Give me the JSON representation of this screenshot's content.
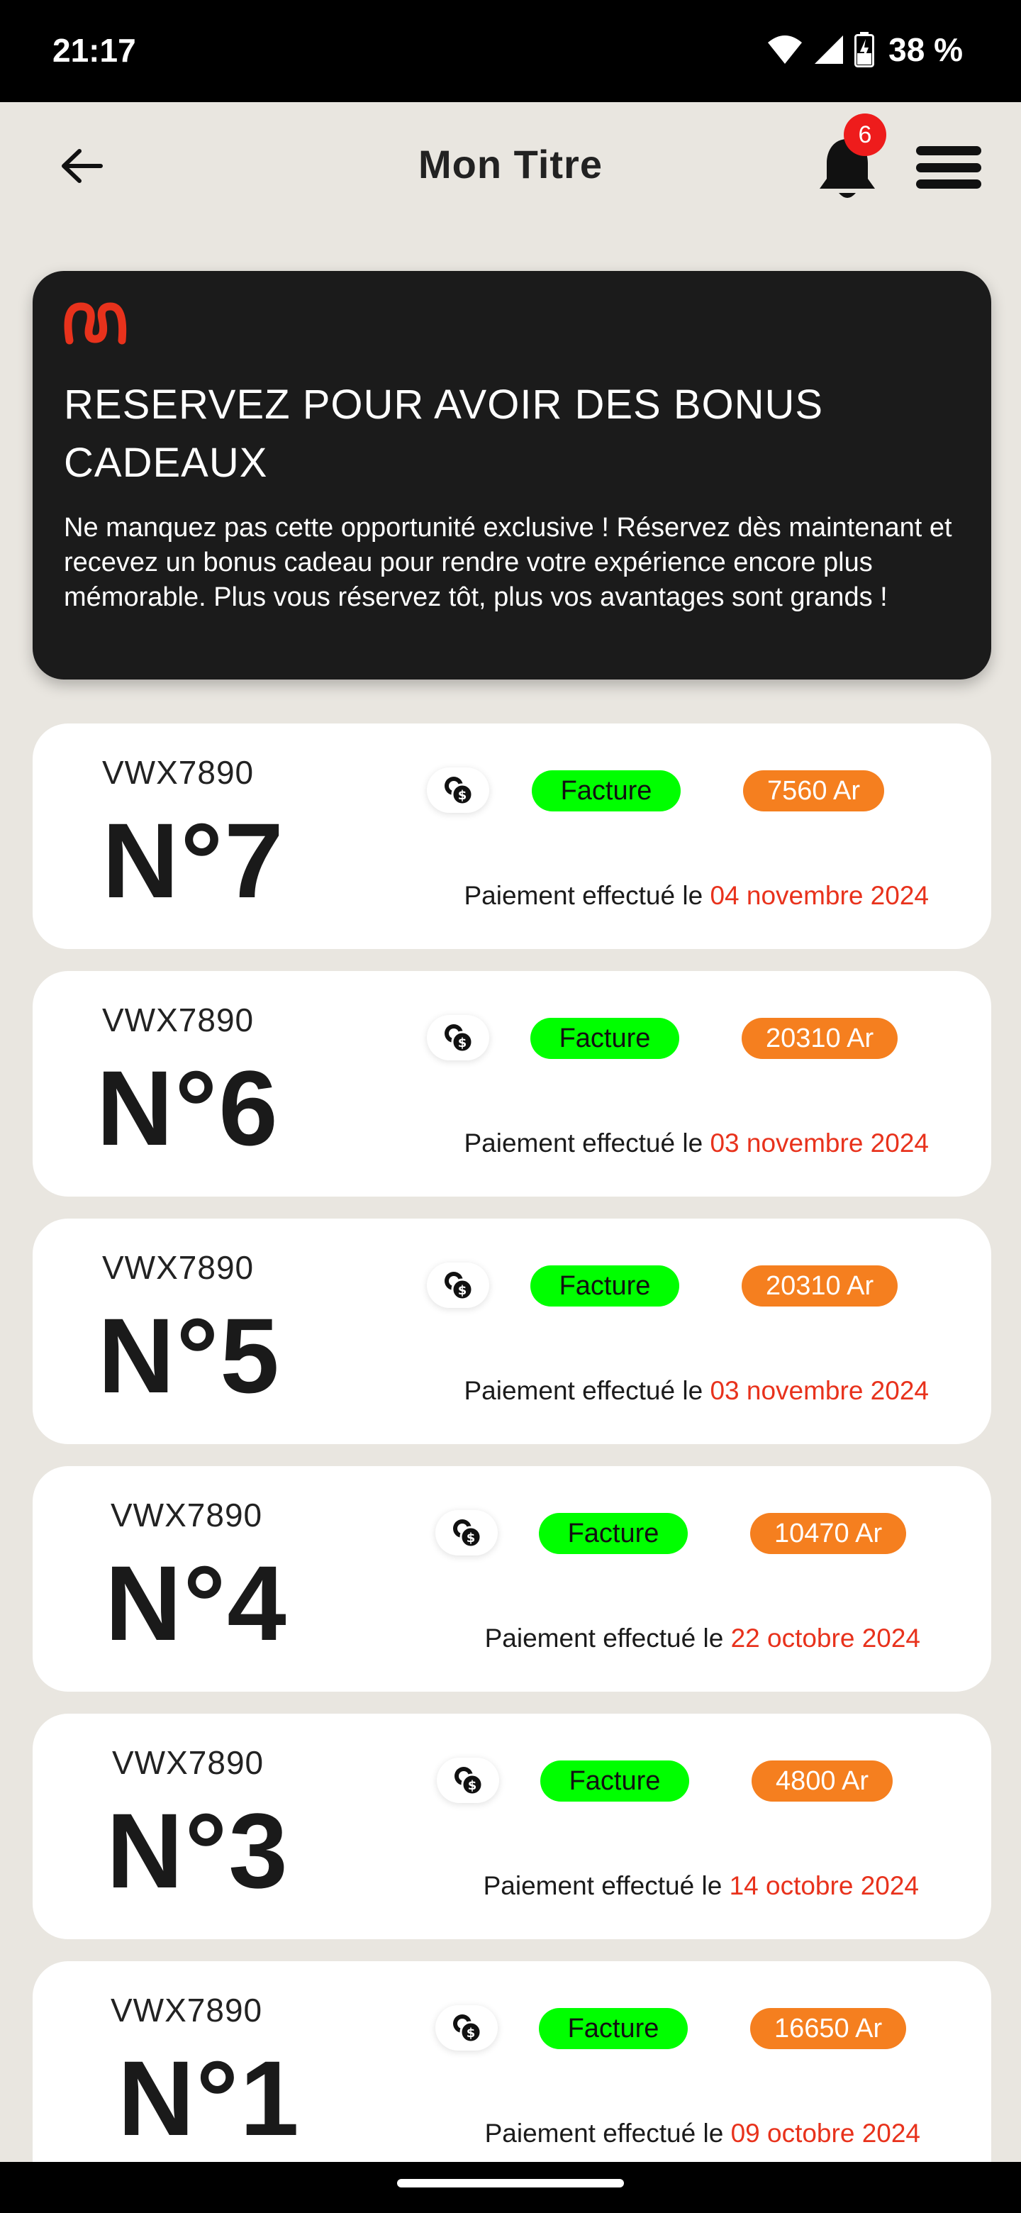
{
  "status_bar": {
    "time": "21:17",
    "battery": "38 %"
  },
  "header": {
    "title": "Mon Titre",
    "notification_count": "6",
    "icons": [
      "arrow-left-icon",
      "bell-icon",
      "hamburger-menu-icon"
    ]
  },
  "promo": {
    "headline": "RESERVEZ POUR AVOIR DES BONUS CADEAUX",
    "body": "Ne manquez pas cette opportunité exclusive ! Réservez dès maintenant et recevez un bonus cadeau pour rendre votre expérience encore plus mémorable. Plus vous réservez tôt, plus vos avantages sont grands !",
    "logo_color": "#e8321c"
  },
  "cards": [
    {
      "ref": "VWX7890",
      "number": "N°7",
      "badge": "Facture",
      "amount": "7560 Ar",
      "payment_label": "Paiement effectué le",
      "date": "04 novembre 2024"
    },
    {
      "ref": "VWX7890",
      "number": "N°6",
      "badge": "Facture",
      "amount": "20310 Ar",
      "payment_label": "Paiement effectué le",
      "date": "03 novembre 2024"
    },
    {
      "ref": "VWX7890",
      "number": "N°5",
      "badge": "Facture",
      "amount": "20310 Ar",
      "payment_label": "Paiement effectué le",
      "date": "03 novembre 2024"
    },
    {
      "ref": "VWX7890",
      "number": "N°4",
      "badge": "Facture",
      "amount": "10470 Ar",
      "payment_label": "Paiement effectué le",
      "date": "22 octobre 2024"
    },
    {
      "ref": "VWX7890",
      "number": "N°3",
      "badge": "Facture",
      "amount": "4800 Ar",
      "payment_label": "Paiement effectué le",
      "date": "14 octobre 2024"
    },
    {
      "ref": "VWX7890",
      "number": "N°1",
      "badge": "Facture",
      "amount": "16650 Ar",
      "payment_label": "Paiement effectué le",
      "date": "09 octobre 2024"
    }
  ],
  "colors": {
    "background": "#e9e6e0",
    "badge_green": "#00ff00",
    "amount_orange": "#f57f1f",
    "date_red": "#e8321c",
    "notification_red": "#ee1c1c"
  }
}
